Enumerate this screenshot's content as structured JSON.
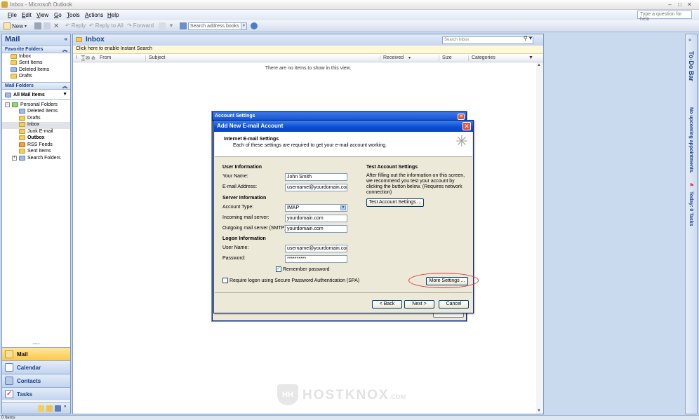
{
  "window": {
    "title": "Inbox - Microsoft Outlook"
  },
  "menu": [
    "File",
    "Edit",
    "View",
    "Go",
    "Tools",
    "Actions",
    "Help"
  ],
  "help_placeholder": "Type a question for help",
  "toolbar": {
    "new": "New",
    "reply": "Reply",
    "reply_all": "Reply to All",
    "forward": "Forward",
    "address_search": "Search address books"
  },
  "nav": {
    "title": "Mail",
    "favorites_header": "Favorite Folders",
    "favorites": [
      "Inbox",
      "Sent Items",
      "Deleted Items",
      "Drafts"
    ],
    "mail_folders_header": "Mail Folders",
    "all_mail": "All Mail Items",
    "personal_folders": "Personal Folders",
    "folders": [
      "Deleted Items",
      "Drafts",
      "Inbox",
      "Junk E-mail",
      "Outbox",
      "RSS Feeds",
      "Sent Items",
      "Search Folders"
    ],
    "buttons": [
      "Mail",
      "Calendar",
      "Contacts",
      "Tasks"
    ]
  },
  "content": {
    "title": "Inbox",
    "search_placeholder": "Search Inbox",
    "instant_search": "Click here to enable Instant Search",
    "columns": [
      "From",
      "Subject",
      "Received",
      "Size",
      "Categories"
    ],
    "empty_message": "There are no items to show in this view."
  },
  "todo_bar": {
    "title": "To-Do Bar",
    "appointments": "No upcoming appointments.",
    "tasks": "Today: 0 Tasks"
  },
  "status": "0 Items",
  "back_dialog": {
    "title": "Account Settings"
  },
  "dialog": {
    "title": "Add New E-mail Account",
    "header_title": "Internet E-mail Settings",
    "header_subtitle": "Each of these settings are required to get your e-mail account working.",
    "user_info": "User Information",
    "your_name_label": "Your Name:",
    "your_name": "John Smith",
    "email_label": "E-mail Address:",
    "email": "username@yourdomain.com",
    "server_info": "Server Information",
    "account_type_label": "Account Type:",
    "account_type": "IMAP",
    "incoming_label": "Incoming mail server:",
    "incoming": "yourdomain.com",
    "outgoing_label": "Outgoing mail server (SMTP):",
    "outgoing": "yourdomain.com",
    "logon_info": "Logon Information",
    "username_label": "User Name:",
    "username": "username@yourdomain.com",
    "password_label": "Password:",
    "password": "**********",
    "remember_password": "Remember password",
    "spa": "Require logon using Secure Password Authentication (SPA)",
    "test_title": "Test Account Settings",
    "test_desc": "After filling out the information on this screen, we recommend you test your account by clicking the button below. (Requires network connection)",
    "test_button": "Test Account Settings ...",
    "more_settings": "More Settings ...",
    "back": "< Back",
    "next": "Next >",
    "cancel": "Cancel"
  },
  "watermark": {
    "brand": "HOSTKNOX",
    "tld": ".COM",
    "mark": "HH"
  }
}
